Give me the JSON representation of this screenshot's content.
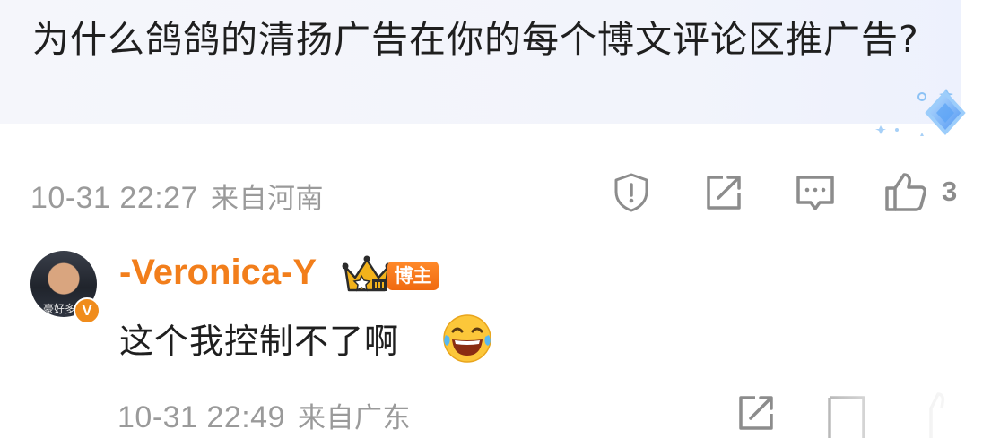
{
  "comment": {
    "text": "为什么鸽鸽的清扬广告在你的每个博文评论区推广告?",
    "timestamp": "10-31 22:27",
    "location": "来自河南",
    "actions": {
      "report_icon": "shield-alert-icon",
      "share_icon": "share-icon",
      "reply_icon": "comment-icon",
      "like_icon": "thumbs-up-icon"
    },
    "like_count": "3"
  },
  "reply": {
    "username": "-Veronica-Y",
    "avatar_watermark": "豪好多",
    "verify_mark": "V",
    "author_tag": "博主",
    "text": "这个我控制不了啊",
    "emoji": "laughing-tears-emoji",
    "timestamp": "10-31 22:49",
    "location": "来自广东"
  },
  "colors": {
    "username": "#f27e1b",
    "meta": "#9a9a9a",
    "bubble": "#f3f5fb",
    "tag": "#f27a1e"
  }
}
